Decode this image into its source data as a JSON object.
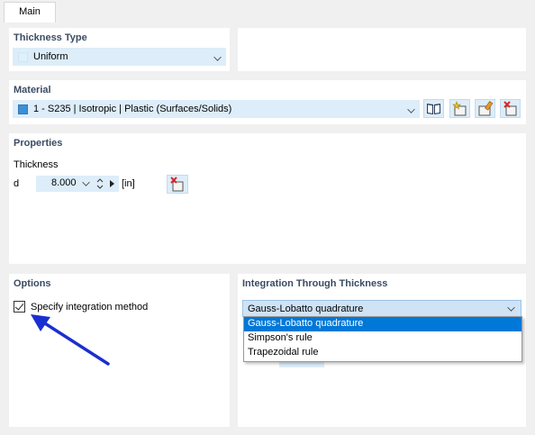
{
  "tabs": [
    {
      "label": "Main"
    }
  ],
  "thickness_type": {
    "title": "Thickness Type",
    "value": "Uniform",
    "swatch_color": "#ddf1f9"
  },
  "material": {
    "title": "Material",
    "value": "1 - S235 | Isotropic | Plastic (Surfaces/Solids)",
    "swatch_color": "#3c8fd6",
    "buttons": [
      "library-icon",
      "new-material-icon",
      "edit-material-icon",
      "delete-material-icon"
    ]
  },
  "properties": {
    "title": "Properties",
    "subtitle": "Thickness",
    "param_symbol": "d",
    "value": "8.000",
    "unit": "[in]"
  },
  "options": {
    "title": "Options",
    "checkbox_label": "Specify integration method",
    "checked": true
  },
  "integration": {
    "title": "Integration Through Thickness",
    "selected": "Gauss-Lobatto quadrature",
    "options": [
      "Gauss-Lobatto quadrature",
      "Simpson's rule",
      "Trapezoidal rule"
    ]
  },
  "colors": {
    "title_color": "#3a4c63",
    "combo_bg": "#ddedf9",
    "selection_bg": "#0078d7",
    "arrow": "#1a2fd0"
  }
}
